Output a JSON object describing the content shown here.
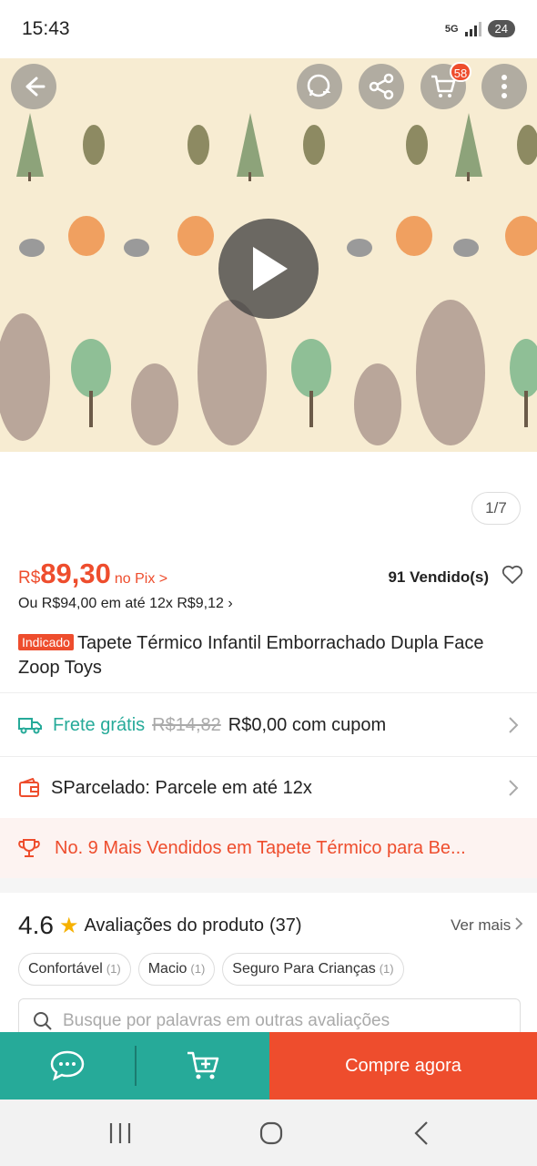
{
  "status_bar": {
    "time": "15:43",
    "network": "5G",
    "battery": "24"
  },
  "hero": {
    "image_counter": "1/7",
    "cart_badge": "58",
    "actions": [
      "back-icon",
      "whatsapp-icon",
      "share-icon",
      "cart-icon",
      "more-icon"
    ]
  },
  "product": {
    "price_currency": "R$",
    "price_value": "89,30",
    "price_method": "no Pix >",
    "sold": "91 Vendido(s)",
    "installment": "Ou R$94,00 em até 12x R$9,12 ›",
    "tag": "Indicado",
    "title": "Tapete Térmico Infantil Emborrachado Dupla Face Zoop Toys"
  },
  "shipping": {
    "label": "Frete grátis",
    "old_price": "R$14,82",
    "new_price": "R$0,00 com cupom"
  },
  "installments": {
    "label": "SParcelado: Parcele em até 12x"
  },
  "ranking": {
    "label": "No. 9 Mais Vendidos em Tapete Térmico para Be..."
  },
  "reviews": {
    "score": "4.6",
    "label": "Avaliações do produto",
    "count": "(37)",
    "see_more": "Ver mais",
    "chips": [
      {
        "label": "Confortável",
        "count": "(1)"
      },
      {
        "label": "Macio",
        "count": "(1)"
      },
      {
        "label": "Seguro Para Crianças",
        "count": "(1)"
      }
    ],
    "search_placeholder": "Busque por palavras em outras avaliações"
  },
  "bottom_bar": {
    "buy_label": "Compre agora"
  },
  "colors": {
    "accent": "#ee4d2d",
    "teal": "#26aa99"
  }
}
